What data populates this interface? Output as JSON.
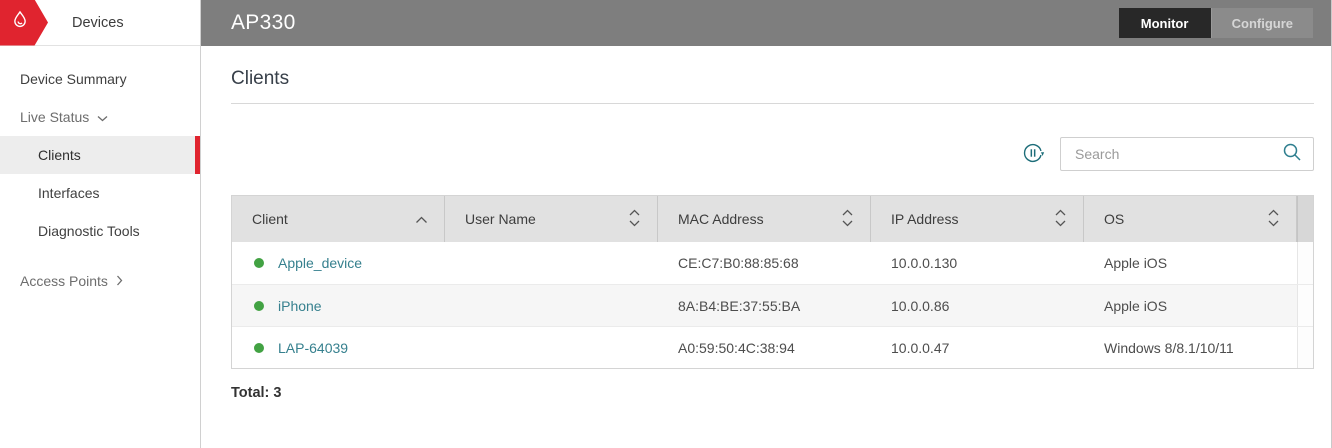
{
  "brand": {
    "label": "Devices"
  },
  "sidebar": {
    "items": [
      {
        "label": "Device Summary"
      },
      {
        "label": "Live Status"
      },
      {
        "label": "Clients"
      },
      {
        "label": "Interfaces"
      },
      {
        "label": "Diagnostic Tools"
      },
      {
        "label": "Access Points"
      }
    ]
  },
  "header": {
    "title": "AP330",
    "buttons": [
      {
        "label": "Monitor",
        "active": true
      },
      {
        "label": "Configure",
        "active": false
      }
    ]
  },
  "main": {
    "heading": "Clients",
    "search": {
      "placeholder": "Search"
    },
    "table": {
      "columns": [
        {
          "label": "Client",
          "sort": "asc"
        },
        {
          "label": "User Name",
          "sort": "none"
        },
        {
          "label": "MAC Address",
          "sort": "none"
        },
        {
          "label": "IP Address",
          "sort": "none"
        },
        {
          "label": "OS",
          "sort": "none"
        }
      ],
      "rows": [
        {
          "status": "online",
          "client": "Apple_device",
          "user_name": "",
          "mac": "CE:C7:B0:88:85:68",
          "ip": "10.0.0.130",
          "os": "Apple iOS"
        },
        {
          "status": "online",
          "client": "iPhone",
          "user_name": "",
          "mac": "8A:B4:BE:37:55:BA",
          "ip": "10.0.0.86",
          "os": "Apple iOS"
        },
        {
          "status": "online",
          "client": "LAP-64039",
          "user_name": "",
          "mac": "A0:59:50:4C:38:94",
          "ip": "10.0.0.47",
          "os": "Windows 8/8.1/10/11"
        }
      ]
    },
    "total_label": "Total: 3"
  },
  "colors": {
    "accent_red": "#e0242f",
    "topbar_gray": "#7e7e7e",
    "link_teal": "#36808e",
    "status_green": "#42a243"
  }
}
